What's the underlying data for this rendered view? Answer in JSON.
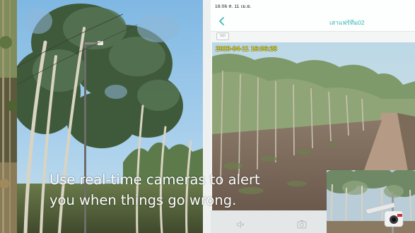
{
  "phone": {
    "status_time": "16:06  ส. 11 เม.ย.",
    "title": "เสาแฟร์ทีม02",
    "sd_badge": "SD",
    "camera_timestamp": "2023-04-11 16:06:28",
    "icons": {
      "back": "chevron-left-icon",
      "volume": "speaker-muted-icon",
      "snapshot": "camera-icon"
    }
  },
  "caption": {
    "line1": "Use real-time cameras to alert",
    "line2": "you when things go wrong."
  },
  "colors": {
    "accent": "#35b7b1",
    "timestamp": "#f1e61a",
    "caption_text": "#ffffff"
  }
}
